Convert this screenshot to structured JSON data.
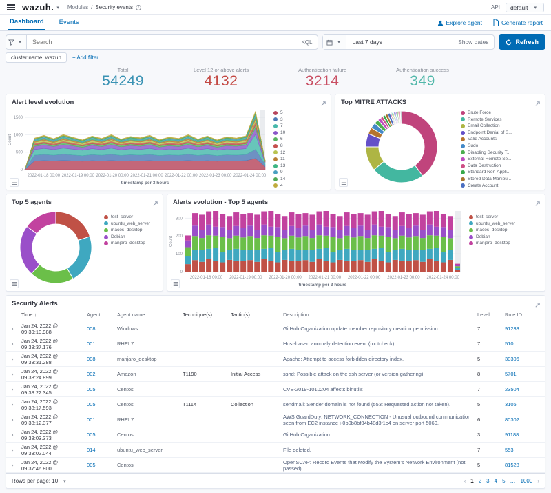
{
  "topbar": {
    "brand": "wazuh.",
    "breadcrumb_module": "Modules",
    "breadcrumb_sep": "/",
    "breadcrumb_page": "Security events",
    "api_label": "API",
    "api_value": "default"
  },
  "tabs": {
    "dashboard": "Dashboard",
    "events": "Events",
    "explore_agent": "Explore agent",
    "generate_report": "Generate report"
  },
  "searchbar": {
    "placeholder": "Search",
    "kql": "KQL",
    "time_range": "Last 7 days",
    "show_dates": "Show dates",
    "refresh": "Refresh"
  },
  "filters": {
    "chip": "cluster.name: wazuh",
    "add_filter": "+ Add filter"
  },
  "stats": {
    "items": [
      {
        "label": "Total",
        "value": "54249",
        "color": "#3b93b4"
      },
      {
        "label": "Level 12 or above alerts",
        "value": "4132",
        "color": "#c34843"
      },
      {
        "label": "Authentication failure",
        "value": "3214",
        "color": "#c94f63"
      },
      {
        "label": "Authentication success",
        "value": "349",
        "color": "#52b8aa"
      }
    ]
  },
  "chart_data": [
    {
      "type": "area",
      "title": "Alert level evolution",
      "xlabel": "timestamp per 3 hours",
      "ylabel": "Count",
      "ylim": [
        0,
        1700
      ],
      "yticks": [
        0,
        500,
        1000,
        1500
      ],
      "x_labels": [
        "2022-01-18 00:00",
        "2022-01-19 00:00",
        "2022-01-20 00:00",
        "2022-01-21 00:00",
        "2022-01-22 00:00",
        "2022-01-23 00:00",
        "2022-01-24 00:00"
      ],
      "series": [
        {
          "name": "5",
          "color": "#b7455c",
          "values": [
            0,
            245,
            258,
            248,
            262,
            250,
            240,
            256,
            246,
            260,
            244,
            254,
            248,
            258,
            242,
            252,
            246,
            260,
            244,
            256,
            240,
            252,
            248,
            256,
            320,
            80
          ]
        },
        {
          "name": "3",
          "color": "#4e79b6",
          "values": [
            0,
            168,
            178,
            165,
            180,
            170,
            160,
            175,
            166,
            180,
            164,
            174,
            168,
            178,
            162,
            172,
            166,
            180,
            164,
            176,
            160,
            172,
            168,
            176,
            260,
            60
          ]
        },
        {
          "name": "7",
          "color": "#47b8ab",
          "values": [
            0,
            162,
            172,
            160,
            175,
            165,
            155,
            170,
            160,
            175,
            158,
            168,
            162,
            172,
            156,
            166,
            160,
            175,
            158,
            170,
            155,
            166,
            162,
            170,
            430,
            50
          ]
        },
        {
          "name": "10",
          "color": "#8a56c9",
          "values": [
            0,
            92,
            100,
            90,
            102,
            95,
            86,
            98,
            90,
            102,
            88,
            96,
            92,
            100,
            86,
            94,
            90,
            102,
            88,
            98,
            86,
            96,
            92,
            98,
            180,
            22
          ]
        },
        {
          "name": "6",
          "color": "#57b35f",
          "values": [
            0,
            40,
            46,
            38,
            48,
            42,
            36,
            44,
            40,
            48,
            38,
            44,
            42,
            46,
            36,
            42,
            40,
            48,
            38,
            44,
            36,
            44,
            40,
            46,
            88,
            10
          ]
        },
        {
          "name": "8",
          "color": "#c5504e",
          "values": [
            0,
            38,
            44,
            36,
            46,
            40,
            34,
            42,
            38,
            46,
            36,
            42,
            40,
            44,
            34,
            40,
            38,
            46,
            36,
            42,
            34,
            42,
            38,
            44,
            80,
            9
          ]
        },
        {
          "name": "12",
          "color": "#b9c351",
          "values": [
            0,
            38,
            43,
            36,
            45,
            40,
            34,
            42,
            37,
            45,
            35,
            41,
            39,
            44,
            34,
            40,
            37,
            45,
            35,
            42,
            34,
            41,
            38,
            43,
            70,
            8
          ]
        },
        {
          "name": "11",
          "color": "#b97e35",
          "values": [
            0,
            28,
            33,
            26,
            34,
            30,
            25,
            32,
            28,
            34,
            26,
            31,
            29,
            33,
            25,
            30,
            28,
            34,
            26,
            32,
            25,
            31,
            28,
            32,
            58,
            7
          ]
        },
        {
          "name": "13",
          "color": "#3eb583",
          "values": [
            0,
            27,
            31,
            25,
            32,
            28,
            24,
            30,
            26,
            32,
            25,
            29,
            27,
            31,
            24,
            28,
            26,
            32,
            25,
            30,
            24,
            29,
            26,
            30,
            54,
            6
          ]
        },
        {
          "name": "9",
          "color": "#4a9fc0",
          "values": [
            0,
            27,
            31,
            25,
            32,
            28,
            24,
            30,
            26,
            32,
            25,
            29,
            27,
            31,
            24,
            28,
            26,
            32,
            25,
            30,
            24,
            29,
            26,
            30,
            54,
            6
          ]
        },
        {
          "name": "14",
          "color": "#51a954",
          "values": [
            0,
            21,
            25,
            20,
            26,
            22,
            19,
            24,
            21,
            26,
            20,
            23,
            22,
            25,
            19,
            22,
            21,
            26,
            20,
            24,
            19,
            23,
            21,
            24,
            44,
            5
          ]
        },
        {
          "name": "4",
          "color": "#c0ab3d",
          "values": [
            0,
            19,
            23,
            18,
            24,
            20,
            17,
            22,
            19,
            24,
            18,
            21,
            20,
            23,
            17,
            20,
            19,
            24,
            18,
            22,
            17,
            21,
            19,
            22,
            40,
            4
          ]
        }
      ]
    },
    {
      "type": "donut",
      "title": "Top MITRE ATTACKS",
      "labels": [
        "Brute Force",
        "Remote Services",
        "Email Collection",
        "Endpoint Denial of S...",
        "Valid Accounts",
        "Sudo",
        "Disabling Security T...",
        "External Remote Se...",
        "Data Destruction",
        "Standard Non-Appli...",
        "Stored Data Manipu...",
        "Create Account"
      ],
      "values": [
        40,
        24,
        11,
        6,
        3,
        2.5,
        2,
        1.5,
        1.2,
        1.2,
        1.2,
        1.2
      ],
      "colors": [
        "#c0447c",
        "#43b7a0",
        "#aeb544",
        "#6450c8",
        "#b5742f",
        "#4489c8",
        "#4cae4f",
        "#bd4cc0",
        "#cd4f86",
        "#39a849",
        "#a8742e",
        "#4a6ec1"
      ],
      "tail": {
        "count": 10,
        "value": 0.52,
        "colors": [
          "#c0447c",
          "#43b7a0",
          "#aeb544",
          "#6450c8",
          "#4489c8",
          "#bd4cc0",
          "#4cae4f",
          "#b5742f",
          "#cd4f86",
          "#8a8f99"
        ]
      }
    },
    {
      "type": "donut",
      "title": "Top 5 agents",
      "labels": [
        "test_server",
        "ubuntu_web_server",
        "macos_desktop",
        "Debian",
        "manjaro_desktop"
      ],
      "values": [
        20,
        22,
        20,
        23,
        15
      ],
      "colors": [
        "#c05146",
        "#3fa8c0",
        "#6bbf49",
        "#9a4fc9",
        "#c2429f"
      ]
    },
    {
      "type": "bar",
      "title": "Alerts evolution - Top 5 agents",
      "xlabel": "timestamp per 3 hours",
      "ylabel": "Count",
      "ylim": [
        0,
        340
      ],
      "yticks": [
        0,
        100,
        200,
        300
      ],
      "x_labels": [
        "2022-01-18 00:00",
        "2022-01-19 00:00",
        "2022-01-20 00:00",
        "2022-01-21 00:00",
        "2022-01-22 00:00",
        "2022-01-23 00:00",
        "2022-01-24 00:00"
      ],
      "series": [
        {
          "name": "test_server",
          "color": "#c05146",
          "values": [
            42,
            65,
            55,
            70,
            60,
            52,
            66,
            62,
            58,
            65,
            55,
            70,
            60,
            52,
            66,
            62,
            58,
            65,
            55,
            70,
            60,
            52,
            66,
            62,
            58,
            65,
            55,
            70,
            60,
            52,
            66,
            62,
            58,
            65,
            55,
            70,
            60,
            52,
            66,
            10
          ]
        },
        {
          "name": "ubuntu_web_server",
          "color": "#3fa8c0",
          "values": [
            45,
            55,
            68,
            58,
            72,
            60,
            54,
            66,
            62,
            55,
            68,
            58,
            72,
            60,
            54,
            66,
            62,
            55,
            68,
            58,
            72,
            60,
            54,
            66,
            62,
            55,
            68,
            58,
            72,
            60,
            54,
            66,
            62,
            55,
            68,
            58,
            72,
            60,
            54,
            12
          ]
        },
        {
          "name": "macos_desktop",
          "color": "#6bbf49",
          "values": [
            50,
            80,
            66,
            76,
            70,
            82,
            68,
            74,
            72,
            80,
            66,
            76,
            70,
            82,
            68,
            74,
            72,
            80,
            66,
            76,
            70,
            82,
            68,
            74,
            72,
            80,
            66,
            76,
            70,
            82,
            68,
            74,
            72,
            80,
            66,
            76,
            70,
            82,
            68,
            8
          ]
        },
        {
          "name": "Debian",
          "color": "#9a4fc9",
          "values": [
            38,
            58,
            46,
            60,
            50,
            56,
            44,
            54,
            52,
            58,
            46,
            60,
            50,
            56,
            44,
            54,
            52,
            58,
            46,
            60,
            50,
            56,
            44,
            54,
            52,
            58,
            46,
            60,
            50,
            56,
            44,
            54,
            52,
            58,
            46,
            60,
            50,
            56,
            44,
            6
          ]
        },
        {
          "name": "manjaro_desktop",
          "color": "#c2429f",
          "values": [
            28,
            70,
            84,
            74,
            88,
            72,
            80,
            76,
            78,
            70,
            84,
            74,
            88,
            72,
            80,
            76,
            78,
            70,
            84,
            74,
            88,
            72,
            80,
            76,
            78,
            70,
            84,
            74,
            88,
            72,
            80,
            76,
            78,
            70,
            84,
            74,
            88,
            72,
            80,
            8
          ]
        }
      ]
    }
  ],
  "table": {
    "title": "Security Alerts",
    "columns": {
      "time": "Time",
      "agent": "Agent",
      "agent_name": "Agent name",
      "technique": "Technique(s)",
      "tactic": "Tactic(s)",
      "description": "Description",
      "level": "Level",
      "rule_id": "Rule ID"
    },
    "sort_icon": "↓",
    "rows": [
      {
        "time": "Jan 24, 2022 @ 09:39:10.988",
        "agent": "008",
        "agent_name": "Windows",
        "technique": "",
        "tactic": "",
        "description": "GitHub Organization update member repository creation permission.",
        "level": "7",
        "rule_id": "91233"
      },
      {
        "time": "Jan 24, 2022 @ 09:38:37.176",
        "agent": "001",
        "agent_name": "RHEL7",
        "technique": "",
        "tactic": "",
        "description": "Host-based anomaly detection event (rootcheck).",
        "level": "7",
        "rule_id": "510"
      },
      {
        "time": "Jan 24, 2022 @ 09:38:31.288",
        "agent": "008",
        "agent_name": "manjaro_desktop",
        "technique": "",
        "tactic": "",
        "description": "Apache: Attempt to access forbidden directory index.",
        "level": "5",
        "rule_id": "30306"
      },
      {
        "time": "Jan 24, 2022 @ 09:38:24.899",
        "agent": "002",
        "agent_name": "Amazon",
        "technique": "T1190",
        "tactic": "Initial Access",
        "description": "sshd: Possible attack on the ssh server (or version gathering).",
        "level": "8",
        "rule_id": "5701"
      },
      {
        "time": "Jan 24, 2022 @ 09:38:22.345",
        "agent": "005",
        "agent_name": "Centos",
        "technique": "",
        "tactic": "",
        "description": "CVE-2019-1010204 affects binutils",
        "level": "7",
        "rule_id": "23504"
      },
      {
        "time": "Jan 24, 2022 @ 09:38:17.593",
        "agent": "005",
        "agent_name": "Centos",
        "technique": "T1114",
        "tactic": "Collection",
        "description": "sendmail: Sender domain is not found (553: Requested action not taken).",
        "level": "5",
        "rule_id": "3105"
      },
      {
        "time": "Jan 24, 2022 @ 09:38:12.377",
        "agent": "001",
        "agent_name": "RHEL7",
        "technique": "",
        "tactic": "",
        "description": "AWS GuardDuty: NETWORK_CONNECTION - Unusual outbound communication seen from EC2 instance i-0b0b8bf34b48d3f1c4 on server port 5060.",
        "level": "6",
        "rule_id": "80302"
      },
      {
        "time": "Jan 24, 2022 @ 09:38:03.373",
        "agent": "005",
        "agent_name": "Centos",
        "technique": "",
        "tactic": "",
        "description": "GitHub Organization.",
        "level": "3",
        "rule_id": "91188"
      },
      {
        "time": "Jan 24, 2022 @ 09:38:02.044",
        "agent": "014",
        "agent_name": "ubuntu_web_server",
        "technique": "",
        "tactic": "",
        "description": "File deleted.",
        "level": "7",
        "rule_id": "553"
      },
      {
        "time": "Jan 24, 2022 @ 09:37:46.800",
        "agent": "005",
        "agent_name": "Centos",
        "technique": "",
        "tactic": "",
        "description": "OpenSCAP: Record Events that Modify the System's Network Environment (not passed)",
        "level": "5",
        "rule_id": "81528"
      }
    ],
    "rows_per_page_label": "Rows per page: 10",
    "pagination": {
      "prev": "‹",
      "pages": [
        "1",
        "2",
        "3",
        "4",
        "5",
        "…",
        "1000"
      ],
      "next": "›",
      "current": "1"
    }
  }
}
